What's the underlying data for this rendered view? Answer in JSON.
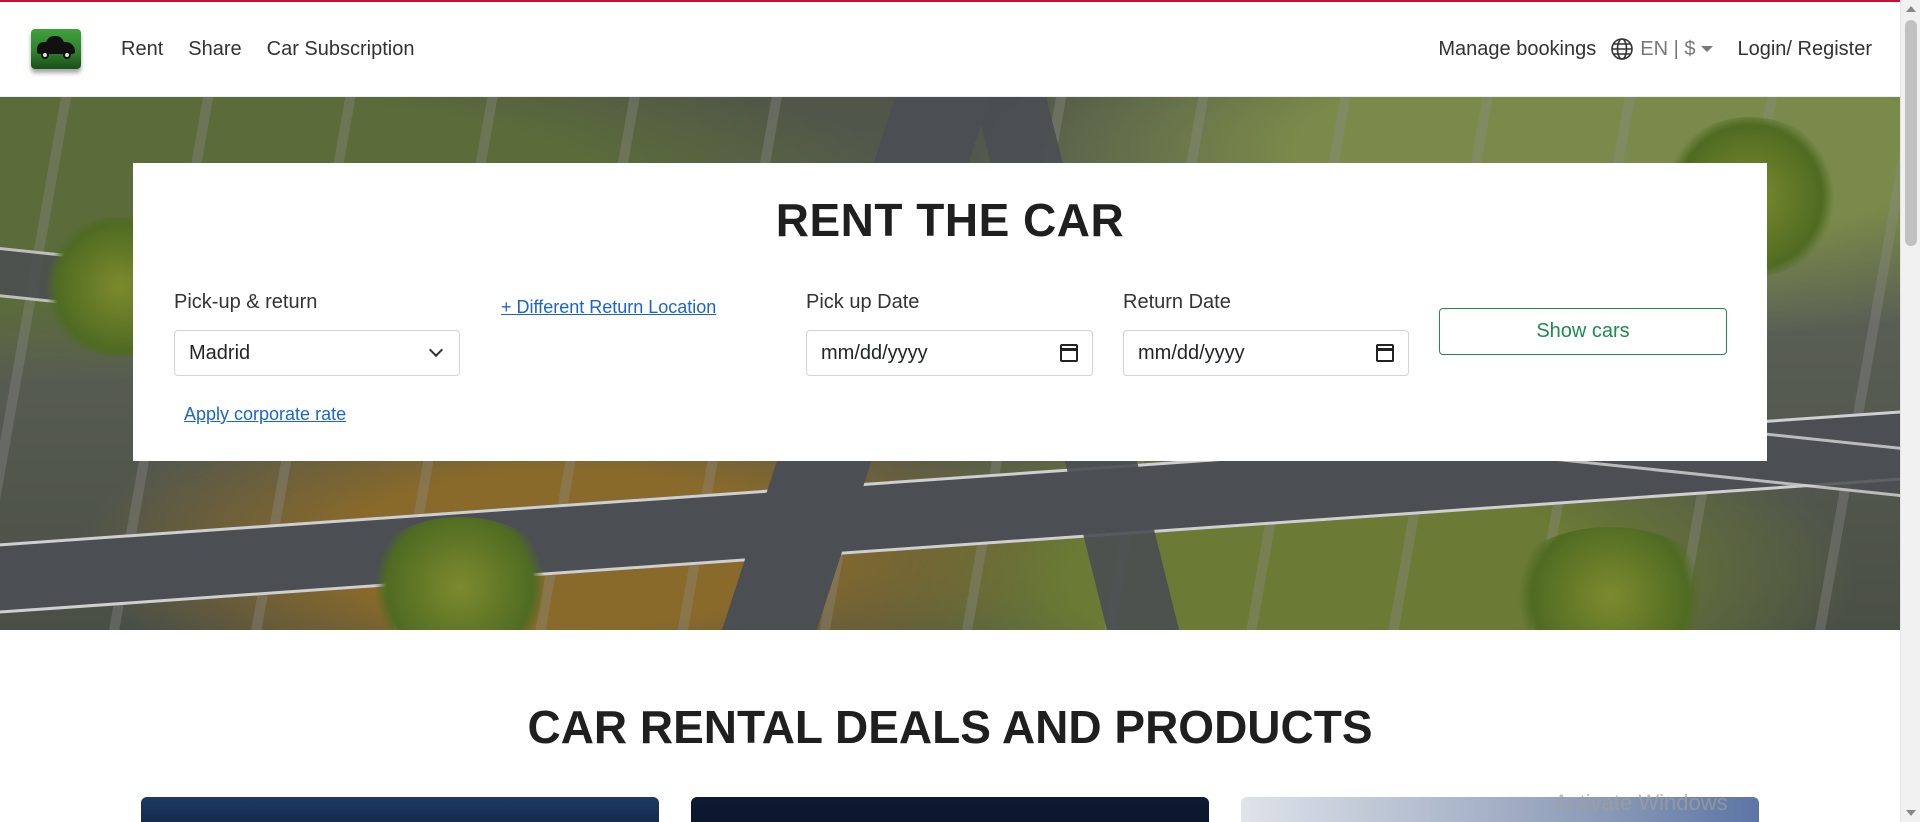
{
  "header": {
    "nav": [
      "Rent",
      "Share",
      "Car Subscription"
    ],
    "manage_bookings": "Manage bookings",
    "locale": "EN | $",
    "login": "Login/ Register"
  },
  "search": {
    "title": "RENT THE CAR",
    "pickup_label": "Pick-up & return",
    "pickup_value": "Madrid",
    "different_return": "+ Different Return Location",
    "pickup_date_label": "Pick up Date",
    "pickup_date_placeholder": "mm/dd/yyyy",
    "return_date_label": "Return Date",
    "return_date_placeholder": "mm/dd/yyyy",
    "show_cars": "Show cars",
    "corporate_rate": "Apply corporate rate"
  },
  "deals": {
    "title": "CAR RENTAL DEALS AND PRODUCTS"
  },
  "os": {
    "watermark": "Activate Windows"
  },
  "colors": {
    "accent_green": "#1e8a4d",
    "link_blue": "#1a63d6",
    "top_accent_red": "#c8102e"
  }
}
